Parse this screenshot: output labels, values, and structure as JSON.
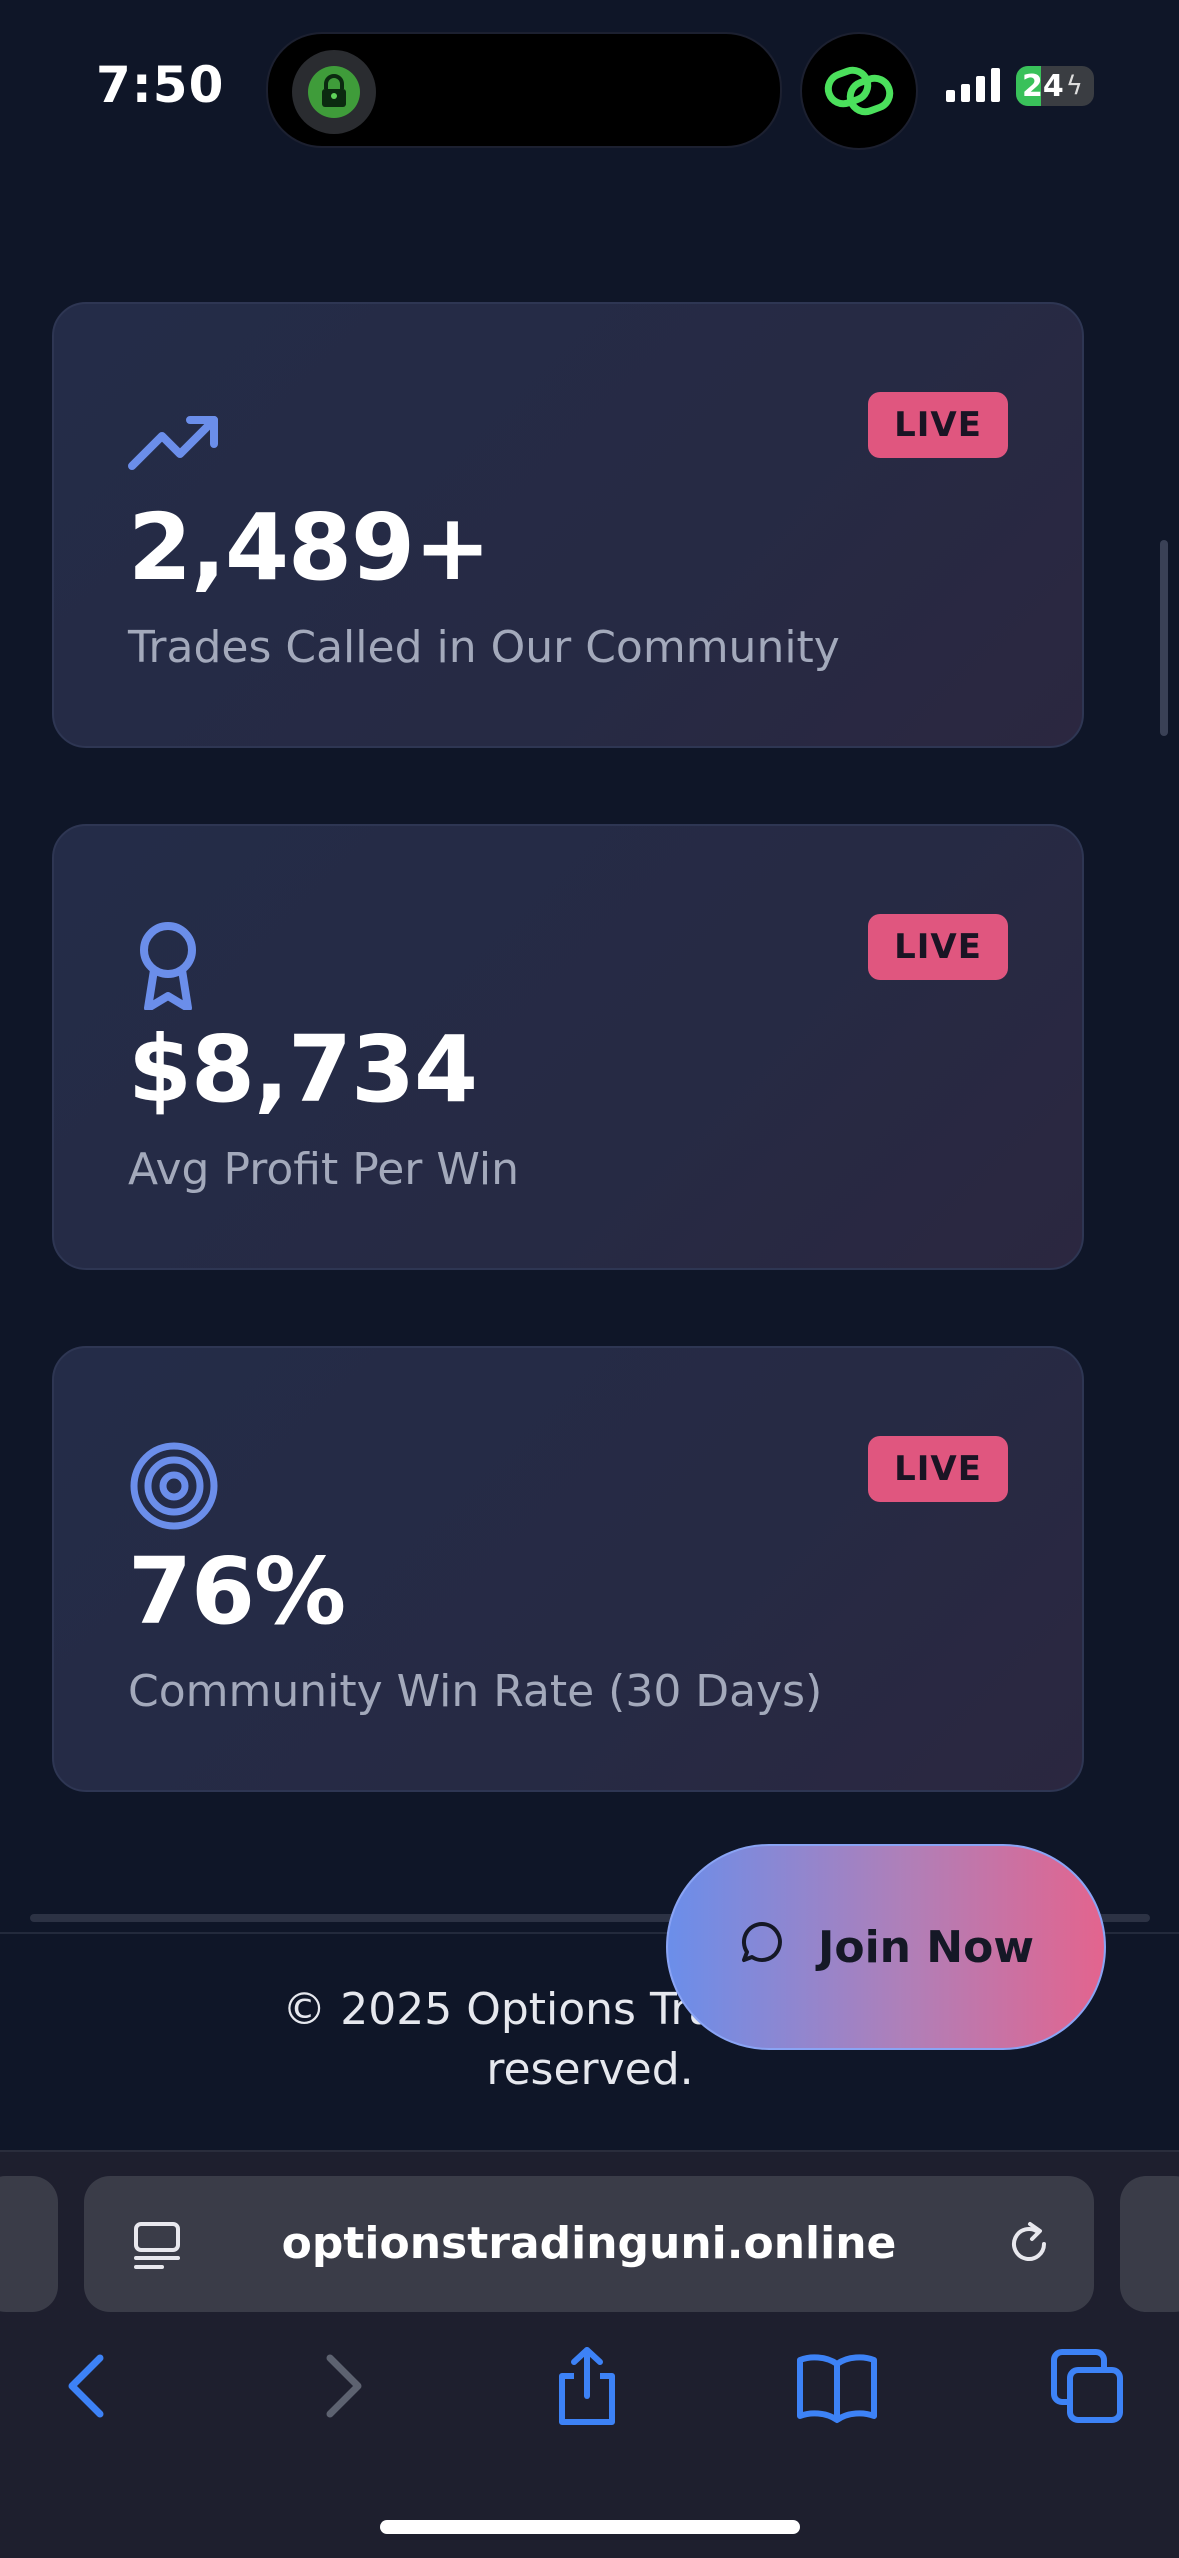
{
  "status_bar": {
    "time": "7:50",
    "battery": "24",
    "battery_level_percent": 24,
    "icons": [
      "vpn-lock-icon",
      "link-icon",
      "signal-icon",
      "battery-icon"
    ]
  },
  "cards": [
    {
      "icon": "trending-up-icon",
      "badge": "LIVE",
      "value": "2,489+",
      "label": "Trades Called in Our Community"
    },
    {
      "icon": "award-icon",
      "badge": "LIVE",
      "value": "$8,734",
      "label": "Avg Profit Per Win"
    },
    {
      "icon": "target-icon",
      "badge": "LIVE",
      "value": "76%",
      "label": "Community Win Rate (30 Days)"
    }
  ],
  "footer": {
    "copyright_line1": "© 2025 Options Trading Uni",
    "copyright_line2": "reserved."
  },
  "join_button": {
    "label": "Join Now",
    "icon": "chat-bubble-icon"
  },
  "browser": {
    "url": "optionstradinguni.online",
    "toolbar": [
      "back-icon",
      "forward-icon",
      "share-icon",
      "bookmarks-icon",
      "tabs-icon"
    ]
  },
  "colors": {
    "background": "#0f1628",
    "badge": "#e0567f",
    "icon_accent": "#6b8eea",
    "button_gradient_start": "#6b8eea",
    "button_gradient_end": "#e3648e"
  }
}
